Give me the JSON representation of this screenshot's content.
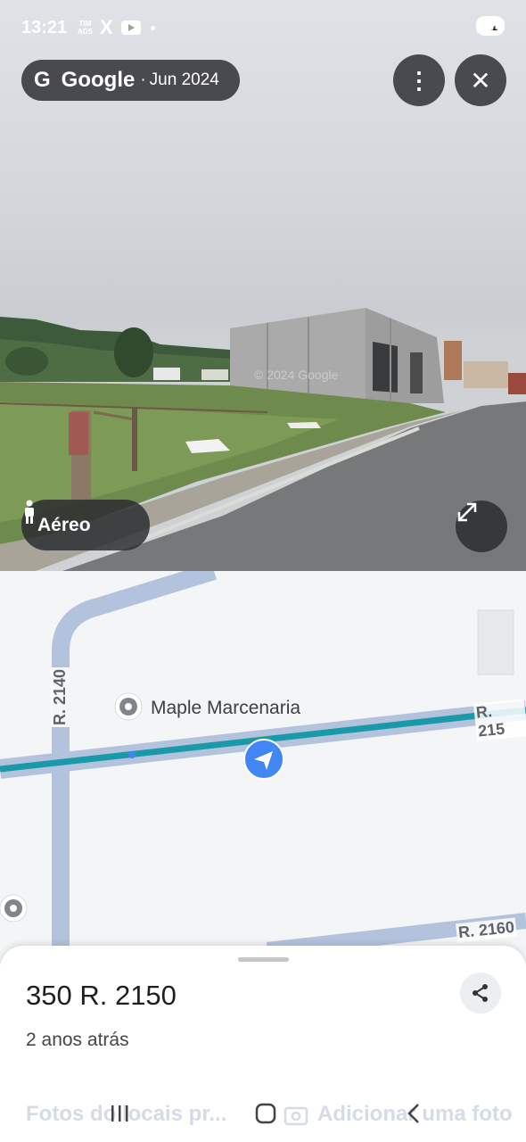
{
  "status_bar": {
    "time": "13:21",
    "carrier_top": "TIM",
    "carrier_bottom": "ADS",
    "x_icon": "X",
    "battery": "81",
    "icons": [
      "x-logo-icon",
      "youtube-icon",
      "location-icon",
      "wifi-icon",
      "signal-icon"
    ]
  },
  "streetview": {
    "g_logo": "G",
    "brand": "Google",
    "separator": "·",
    "date": "Jun 2024",
    "watermark": "© 2024 Google",
    "more_label": "⋮",
    "close_label": "✕",
    "aereo_label": "Aéreo"
  },
  "map": {
    "poi_name": "Maple Marcenaria",
    "roads": {
      "r2140": "R. 2140",
      "r2150": "R. 215",
      "r2160": "R. 2160"
    }
  },
  "place": {
    "address": "350 R. 2150",
    "time_ago": "2 anos atrás",
    "faded_left": "Fotos do locais pr...",
    "faded_right": "Adicionar uma foto"
  },
  "colors": {
    "route": "#1a9aa8",
    "road": "#b3c3de",
    "nav_blue": "#4285f4"
  }
}
